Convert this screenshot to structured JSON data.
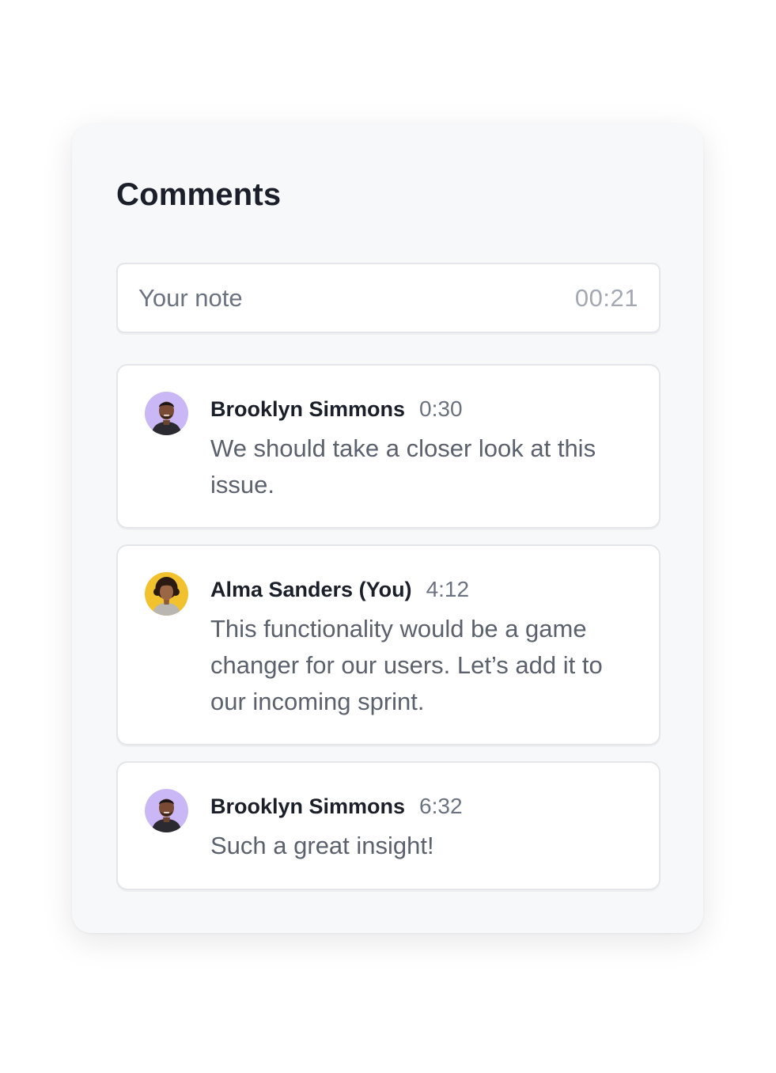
{
  "panel": {
    "title": "Comments"
  },
  "note_input": {
    "placeholder": "Your note",
    "timestamp": "00:21"
  },
  "comments": [
    {
      "author": "Brooklyn Simmons",
      "time": "0:30",
      "text": "We should take a closer look at this issue.",
      "avatar_bg": "#c9b8f5"
    },
    {
      "author": "Alma Sanders (You)",
      "time": "4:12",
      "text": "This functionality would be a game changer for our users. Let’s add it to our incoming sprint.",
      "avatar_bg": "#f2c12e"
    },
    {
      "author": "Brooklyn Simmons",
      "time": "6:32",
      "text": "Such a great insight!",
      "avatar_bg": "#c9b8f5"
    }
  ]
}
